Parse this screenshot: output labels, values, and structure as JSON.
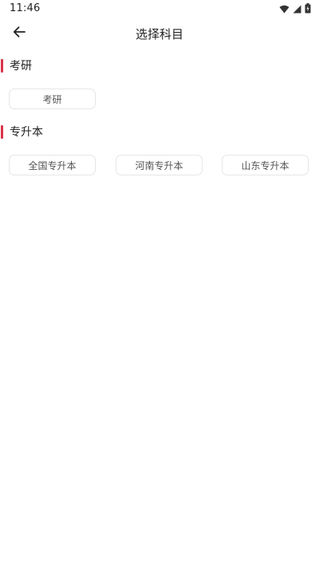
{
  "status_bar": {
    "time": "11:46",
    "icons": [
      "wifi-icon",
      "cellular-signal-icon",
      "battery-charging-icon"
    ]
  },
  "app_bar": {
    "back_icon": "arrow-left-icon",
    "title": "选择科目"
  },
  "sections": [
    {
      "title": "考研",
      "options": [
        "考研"
      ]
    },
    {
      "title": "专升本",
      "options": [
        "全国专升本",
        "河南专升本",
        "山东专升本"
      ]
    }
  ],
  "colors": {
    "accent": "#d8334a",
    "chip_border": "#e6e6e6",
    "chip_text": "#555555",
    "text": "#222222",
    "background": "#ffffff"
  }
}
